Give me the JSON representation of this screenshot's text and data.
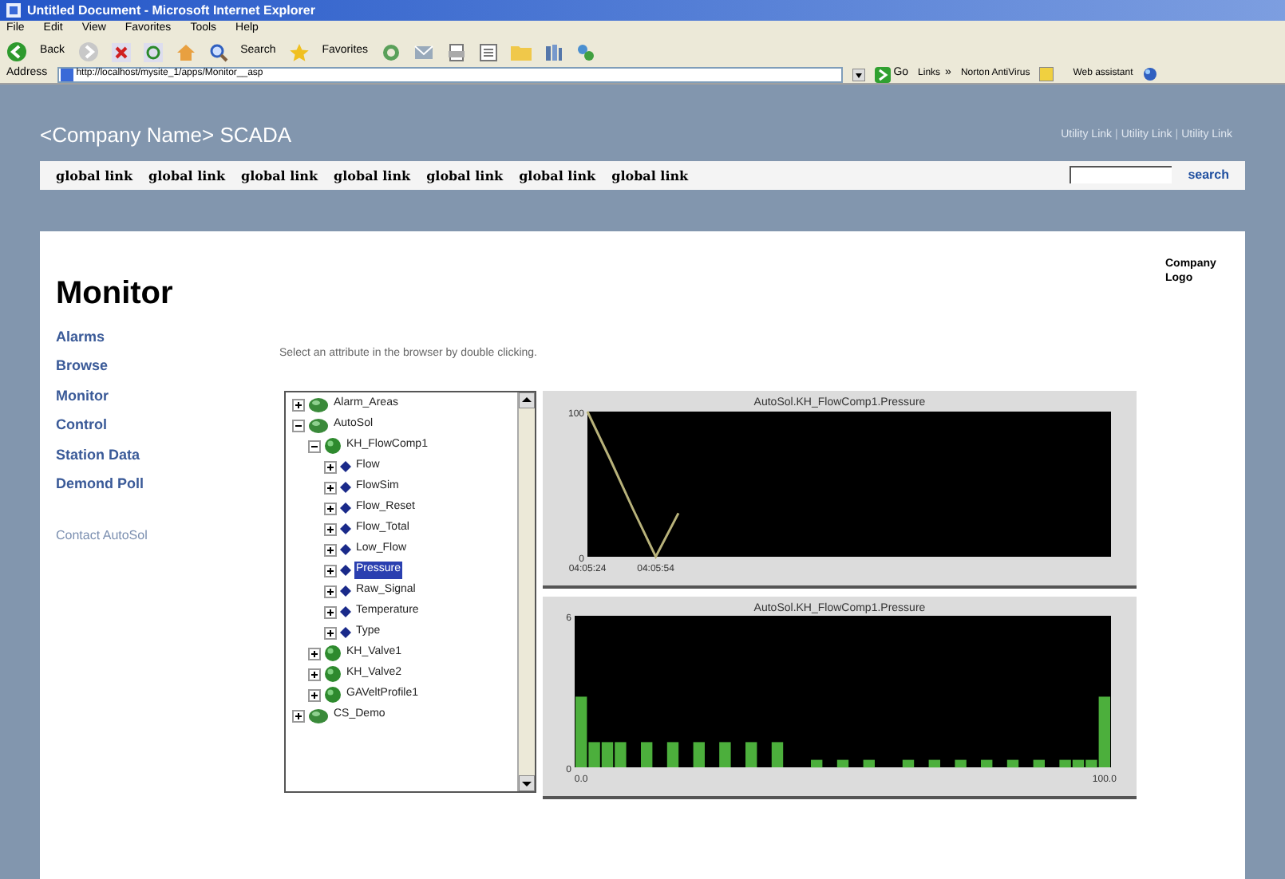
{
  "window": {
    "title": "Untitled Document - Microsoft Internet Explorer"
  },
  "menu": [
    "File",
    "Edit",
    "View",
    "Favorites",
    "Tools",
    "Help"
  ],
  "toolbar": {
    "back": "Back",
    "search": "Search",
    "favorites": "Favorites"
  },
  "address_bar": {
    "label": "Address",
    "value": "http://localhost/mysite_1/apps/Monitor__asp",
    "go": "Go",
    "links": "Links",
    "more": "»",
    "norton": "Norton AntiVirus",
    "assistant": "Web assistant"
  },
  "site": {
    "title": "<Company Name> SCADA",
    "utility_links": [
      "Utility Link",
      "Utility Link",
      "Utility Link"
    ],
    "utility_separators": [
      "|",
      "|"
    ],
    "global_links": [
      "global link",
      "global link",
      "global link",
      "global link",
      "global link",
      "global link",
      "global link"
    ],
    "search": "search"
  },
  "page": {
    "heading": "Monitor",
    "logo": "Company Logo",
    "nav": [
      {
        "label": "Alarms",
        "kind": "main"
      },
      {
        "label": "Browse",
        "kind": "main"
      },
      {
        "label": "Monitor",
        "kind": "main"
      },
      {
        "label": "Control",
        "kind": "main"
      },
      {
        "label": "Station Data",
        "kind": "main"
      },
      {
        "label": "Demond Poll",
        "kind": "main"
      },
      {
        "label": "Contact AutoSol",
        "kind": "contact"
      }
    ],
    "instruction": "Select an attribute in the browser by double clicking.",
    "tree": [
      {
        "label": "Alarm_Areas",
        "kind": "group",
        "expanded": false,
        "selected": false
      },
      {
        "label": "AutoSol",
        "kind": "group",
        "expanded": true,
        "selected": false,
        "children": [
          {
            "label": "KH_FlowComp1",
            "kind": "device",
            "expanded": true,
            "selected": false,
            "children": [
              {
                "label": "Flow",
                "kind": "attribute",
                "expanded": false,
                "selected": false
              },
              {
                "label": "FlowSim",
                "kind": "attribute",
                "expanded": false,
                "selected": false
              },
              {
                "label": "Flow_Reset",
                "kind": "attribute",
                "expanded": false,
                "selected": false
              },
              {
                "label": "Flow_Total",
                "kind": "attribute",
                "expanded": false,
                "selected": false
              },
              {
                "label": "Low_Flow",
                "kind": "attribute",
                "expanded": false,
                "selected": false
              },
              {
                "label": "Pressure",
                "kind": "attribute",
                "expanded": false,
                "selected": true
              },
              {
                "label": "Raw_Signal",
                "kind": "attribute",
                "expanded": false,
                "selected": false
              },
              {
                "label": "Temperature",
                "kind": "attribute",
                "expanded": false,
                "selected": false
              },
              {
                "label": "Type",
                "kind": "attribute",
                "expanded": false,
                "selected": false
              }
            ]
          },
          {
            "label": "KH_Valve1",
            "kind": "device",
            "expanded": false,
            "selected": false
          },
          {
            "label": "KH_Valve2",
            "kind": "device",
            "expanded": false,
            "selected": false
          },
          {
            "label": "GAVeltProfile1",
            "kind": "device",
            "expanded": false,
            "selected": false
          }
        ]
      },
      {
        "label": "CS_Demo",
        "kind": "group",
        "expanded": false,
        "selected": false
      }
    ],
    "charts": [
      {
        "chart_data": {
          "type": "line",
          "title": "AutoSol.KH_FlowComp1.Pressure",
          "ylim": [
            0,
            100
          ],
          "yticks": [
            0,
            100
          ],
          "categories": [
            "04:05:24",
            null,
            null,
            "04:05:54",
            null,
            null,
            null,
            null,
            null,
            null,
            null,
            null,
            null,
            null,
            null,
            null,
            null,
            null,
            null,
            null,
            null,
            null,
            null,
            null
          ],
          "series": [
            {
              "color": "#b8b27a",
              "values": [
                100,
                67,
                33,
                0,
                30,
                null,
                null,
                null,
                null,
                null,
                null,
                null,
                null,
                null,
                null,
                null,
                null,
                null,
                null,
                null,
                null,
                null,
                null,
                null
              ]
            }
          ]
        }
      },
      {
        "chart_data": {
          "type": "bar",
          "title": "AutoSol.KH_FlowComp1.Pressure",
          "ylim": [
            0,
            6
          ],
          "yticks": [
            0,
            6
          ],
          "categories": [
            "0.0",
            null,
            null,
            null,
            null,
            null,
            null,
            null,
            null,
            null,
            null,
            null,
            null,
            null,
            null,
            null,
            null,
            null,
            null,
            null,
            null,
            null,
            null,
            null,
            null,
            null,
            null,
            null,
            null,
            null,
            null,
            null,
            null,
            null,
            null,
            null,
            null,
            null,
            null,
            null,
            "100.0"
          ],
          "series": [
            {
              "color": "#4caf3c",
              "values": [
                2.8,
                1,
                1,
                1,
                0,
                1,
                0,
                1,
                0,
                1,
                0,
                1,
                0,
                1,
                0,
                1,
                0,
                0,
                0.3,
                0,
                0.3,
                0,
                0.3,
                0,
                0,
                0.3,
                0,
                0.3,
                0,
                0.3,
                0,
                0.3,
                0,
                0.3,
                0,
                0.3,
                0,
                0.3,
                0.3,
                0.3,
                2.8
              ]
            }
          ]
        }
      }
    ]
  }
}
